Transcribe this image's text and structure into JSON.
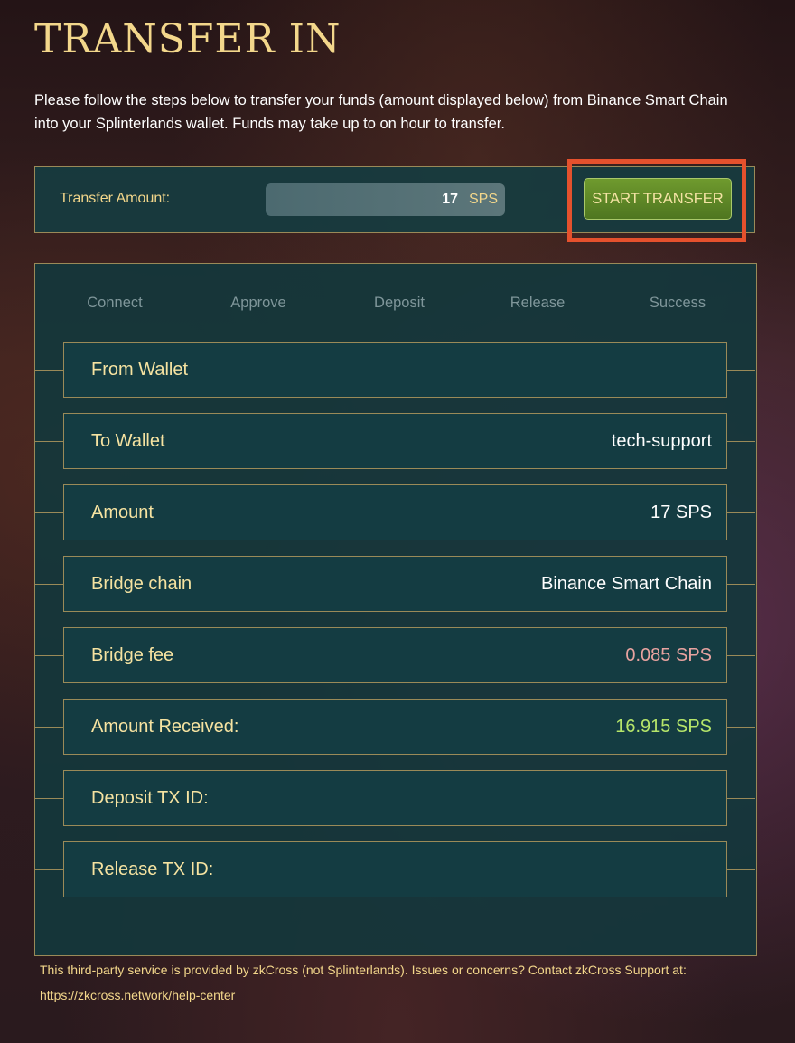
{
  "page": {
    "title": "TRANSFER IN",
    "intro": "Please follow the steps below to transfer your funds (amount displayed below) from Binance Smart Chain into your Splinterlands wallet. Funds may take up to on hour to transfer."
  },
  "transfer": {
    "label": "Transfer Amount:",
    "amount": "17",
    "unit": "SPS",
    "start_button": "START TRANSFER"
  },
  "steps": [
    "Connect",
    "Approve",
    "Deposit",
    "Release",
    "Success"
  ],
  "details": {
    "from_wallet": {
      "label": "From Wallet",
      "value": ""
    },
    "to_wallet": {
      "label": "To Wallet",
      "value": "tech-support"
    },
    "amount": {
      "label": "Amount",
      "value": "17 SPS"
    },
    "bridge_chain": {
      "label": "Bridge chain",
      "value": "Binance Smart Chain"
    },
    "bridge_fee": {
      "label": "Bridge fee",
      "value": "0.085 SPS"
    },
    "amount_received": {
      "label": "Amount Received:",
      "value": "16.915 SPS"
    },
    "deposit_tx": {
      "label": "Deposit TX ID:",
      "value": ""
    },
    "release_tx": {
      "label": "Release TX ID:",
      "value": ""
    }
  },
  "footer": {
    "text": "This third-party service is provided by zkCross (not Splinterlands). Issues or concerns? Contact zkCross Support at:",
    "link": "https://zkcross.network/help-center"
  },
  "colors": {
    "accent_gold": "#f3d78b",
    "panel_teal": "#143c42",
    "button_green": "#5c8a27",
    "highlight_red": "#e5512d",
    "fee_pink": "#e9a3a0",
    "received_green": "#b6e66a"
  }
}
